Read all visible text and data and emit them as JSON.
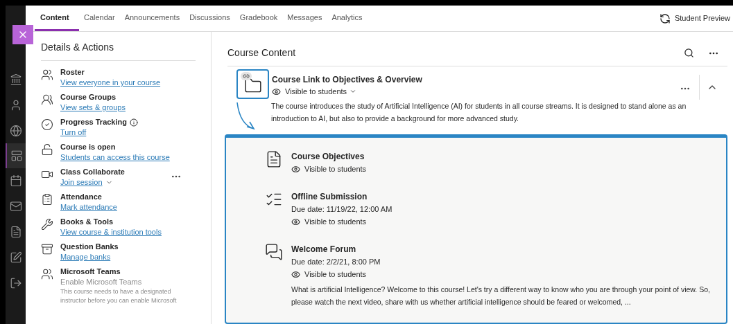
{
  "tabs": [
    {
      "label": "Content",
      "selected": true
    },
    {
      "label": "Calendar",
      "selected": false
    },
    {
      "label": "Announcements",
      "selected": false
    },
    {
      "label": "Discussions",
      "selected": false
    },
    {
      "label": "Gradebook",
      "selected": false
    },
    {
      "label": "Messages",
      "selected": false
    },
    {
      "label": "Analytics",
      "selected": false
    }
  ],
  "student_preview": "Student Preview",
  "nav": [
    {
      "selected": false
    },
    {
      "selected": false
    },
    {
      "selected": false
    },
    {
      "selected": true
    },
    {
      "selected": false
    },
    {
      "selected": false
    },
    {
      "selected": false
    },
    {
      "selected": false
    },
    {
      "selected": false
    }
  ],
  "details": {
    "title": "Details & Actions",
    "items": [
      {
        "kind": "link",
        "title": "Roster",
        "link": "View everyone in your course"
      },
      {
        "kind": "link",
        "title": "Course Groups",
        "link": "View sets & groups"
      },
      {
        "kind": "info",
        "title": "Progress Tracking",
        "link": "Turn off"
      },
      {
        "kind": "link",
        "title": "Course is open",
        "link": "Students can access this course"
      },
      {
        "kind": "session",
        "title": "Class Collaborate",
        "link": "Join session"
      },
      {
        "kind": "link",
        "title": "Attendance",
        "link": "Mark attendance"
      },
      {
        "kind": "link",
        "title": "Books & Tools",
        "link": "View course & institution tools"
      },
      {
        "kind": "link",
        "title": "Question Banks",
        "link": "Manage banks"
      },
      {
        "kind": "disabled",
        "title": "Microsoft Teams",
        "link": "Enable Microsoft Teams",
        "note": "This course needs to have a designated instructor before you can enable Microsoft"
      }
    ]
  },
  "content": {
    "title": "Course Content",
    "folder": {
      "title": "Course Link to Objectives & Overview",
      "visibility": "Visible to students",
      "expanded": true,
      "description": "The course introduces the study of Artificial Intelligence (AI) for students in all course streams. It is designed to stand alone as an introduction to AI, but also to provide a background for more advanced study.",
      "children": [
        {
          "kind": "document",
          "title": "Course Objectives",
          "visibility": "Visible to students"
        },
        {
          "kind": "assignment",
          "title": "Offline Submission",
          "due": "Due date: 11/19/22, 12:00 AM",
          "visibility": "Visible to students"
        },
        {
          "kind": "discussion",
          "title": "Welcome Forum",
          "due": "Due date: 2/2/21, 8:00 PM",
          "visibility": "Visible to students",
          "description": "What is artificial Intelligence? Welcome to this course! Let's try a different way to know who you are through your point of view. So, please watch the next video, share with us whether artificial intelligence should be feared or welcomed, ..."
        }
      ]
    }
  }
}
